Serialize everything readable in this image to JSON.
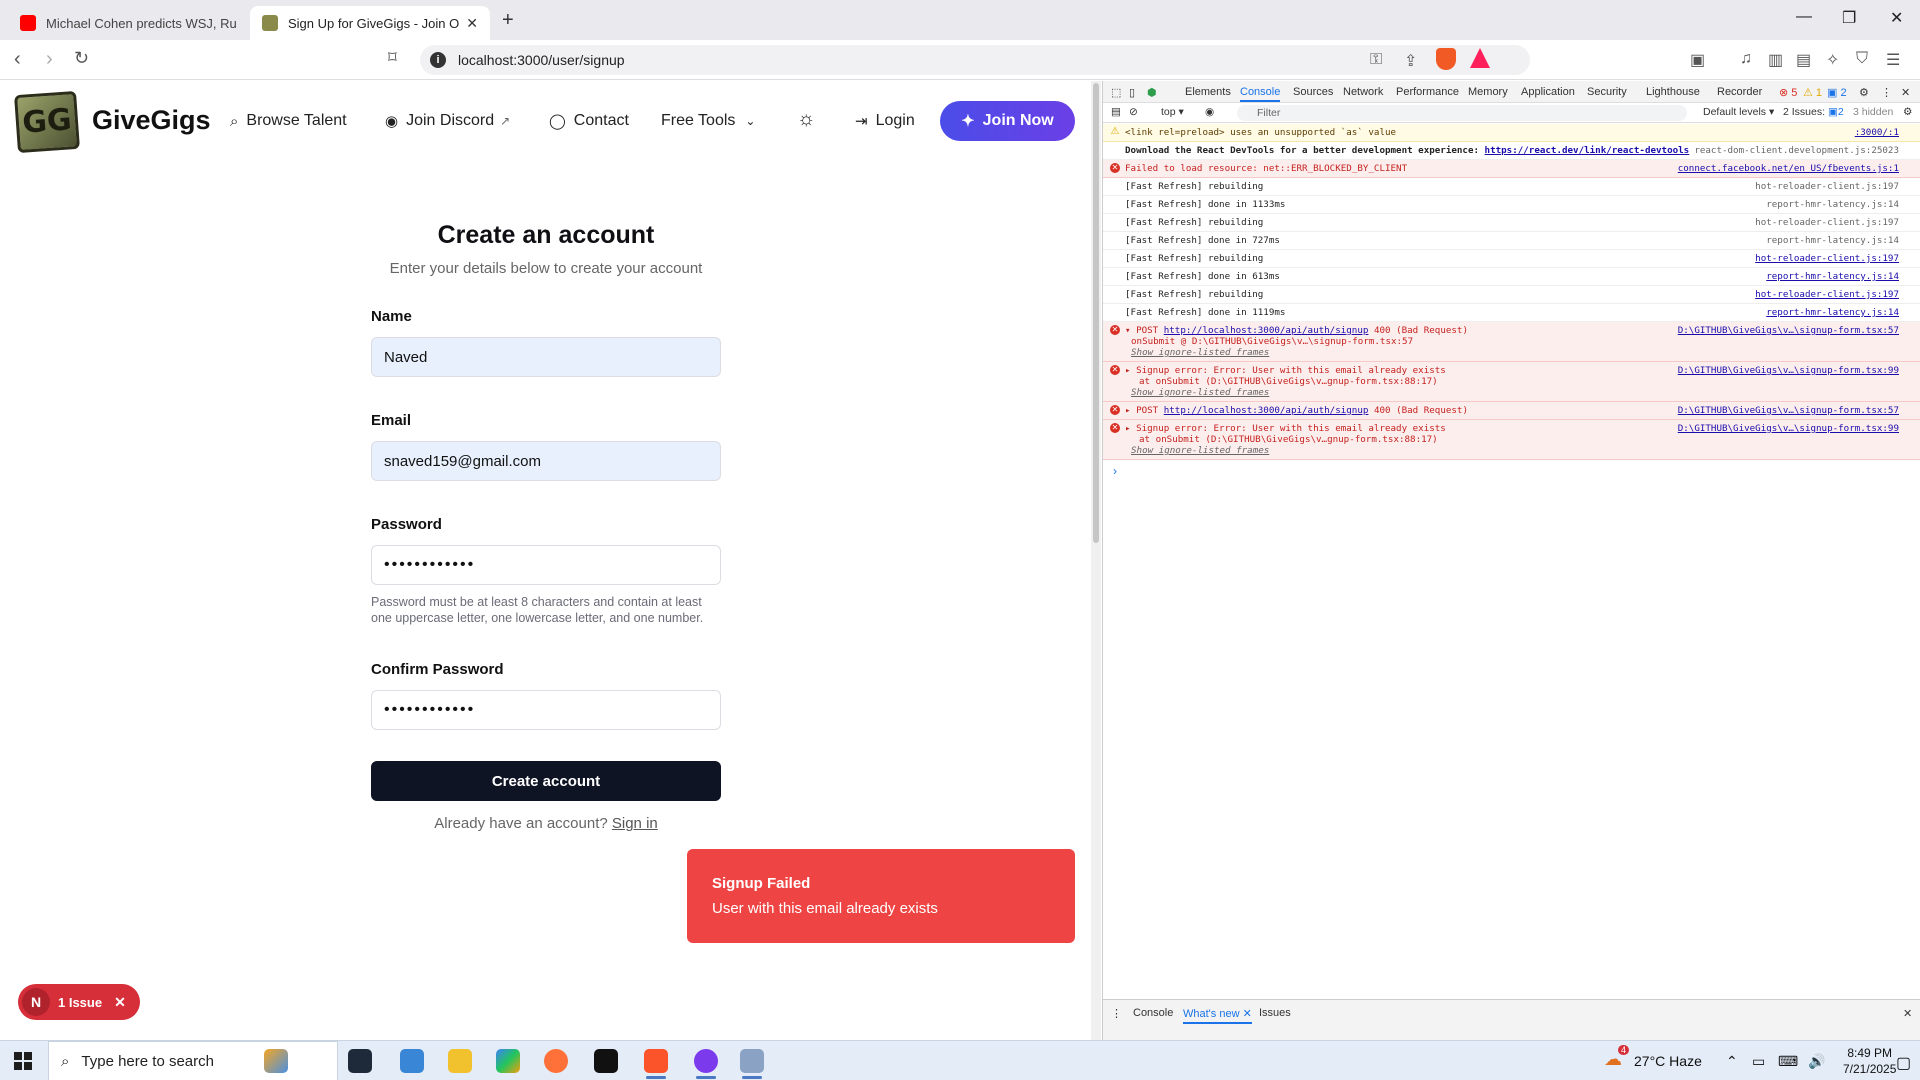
{
  "browser": {
    "tabs": [
      {
        "title": "Michael Cohen predicts WSJ, Rupert",
        "favicon_color": "#ff0000"
      },
      {
        "title": "Sign Up for GiveGigs - Join Our C",
        "favicon_color": "#8a8a4a"
      }
    ],
    "url": "localhost:3000/user/signup"
  },
  "site": {
    "brand": "GiveGigs",
    "logo_text": "GG",
    "nav": {
      "browse": "Browse Talent",
      "discord": "Join Discord",
      "contact": "Contact",
      "tools": "Free Tools",
      "login": "Login",
      "join": "Join Now"
    }
  },
  "form": {
    "title": "Create an account",
    "subtitle": "Enter your details below to create your account",
    "name_label": "Name",
    "name_value": "Naved",
    "email_label": "Email",
    "email_value": "snaved159@gmail.com",
    "password_label": "Password",
    "password_value": "••••••••••••",
    "password_hint": "Password must be at least 8 characters and contain at least one uppercase letter, one lowercase letter, and one number.",
    "confirm_label": "Confirm Password",
    "confirm_value": "••••••••••••",
    "submit": "Create account",
    "signin_prefix": "Already have an account?",
    "signin_link": "Sign in"
  },
  "toast": {
    "title": "Signup Failed",
    "message": "User with this email already exists"
  },
  "issue_pill": {
    "badge": "N",
    "label": "1 Issue"
  },
  "devtools": {
    "tabs": [
      "Elements",
      "Console",
      "Sources",
      "Network",
      "Performance",
      "Memory",
      "Application",
      "Security",
      "Lighthouse",
      "Recorder"
    ],
    "counts": {
      "errors": "5",
      "warnings": "1",
      "info": "2"
    },
    "context": "top",
    "filter_placeholder": "Filter",
    "levels": "Default levels",
    "issues": "2 Issues:",
    "issues_count": "2",
    "hidden": "3 hidden",
    "lines": [
      {
        "type": "warn",
        "text": "<link rel=preload> uses an unsupported `as` value",
        "src": ":3000/:1",
        "src_link": true
      },
      {
        "type": "info-bold",
        "text": "Download the React DevTools for a better development experience: ",
        "link": "https://react.dev/link/react-devtools",
        "src": "react-dom-client.development.js:25023",
        "src_link": false
      },
      {
        "type": "err",
        "text": "Failed to load resource: net::ERR_BLOCKED_BY_CLIENT",
        "src": "connect.facebook.net/en_US/fbevents.js:1",
        "src_link": true
      },
      {
        "type": "log",
        "text": "[Fast Refresh] rebuilding",
        "src": "hot-reloader-client.js:197",
        "src_link": false
      },
      {
        "type": "log",
        "text": "[Fast Refresh] done in 1133ms",
        "src": "report-hmr-latency.js:14",
        "src_link": false
      },
      {
        "type": "log",
        "text": "[Fast Refresh] rebuilding",
        "src": "hot-reloader-client.js:197",
        "src_link": false
      },
      {
        "type": "log",
        "text": "[Fast Refresh] done in 727ms",
        "src": "report-hmr-latency.js:14",
        "src_link": false
      },
      {
        "type": "log",
        "text": "[Fast Refresh] rebuilding",
        "src": "hot-reloader-client.js:197",
        "src_link": true
      },
      {
        "type": "log",
        "text": "[Fast Refresh] done in 613ms",
        "src": "report-hmr-latency.js:14",
        "src_link": true
      },
      {
        "type": "log",
        "text": "[Fast Refresh] rebuilding",
        "src": "hot-reloader-client.js:197",
        "src_link": true
      },
      {
        "type": "log",
        "text": "[Fast Refresh] done in 1119ms",
        "src": "report-hmr-latency.js:14",
        "src_link": true
      }
    ],
    "errors": [
      {
        "prefix": "▾ POST ",
        "link": "http://localhost:3000/api/auth/signup",
        "suffix": " 400 (Bad Request)",
        "sub": "onSubmit @ D:\\GITHUB\\GiveGigs\\v…\\signup-form.tsx:57",
        "sub2": "Show ignore-listed frames",
        "src": "D:\\GITHUB\\GiveGigs\\v…\\signup-form.tsx:57"
      },
      {
        "prefix": "▸ Signup error: Error: User with this email already exists",
        "link": "",
        "suffix": "",
        "sub": "at onSubmit (D:\\GITHUB\\GiveGigs\\v…gnup-form.tsx:88:17)",
        "sub2": "Show ignore-listed frames",
        "src": "D:\\GITHUB\\GiveGigs\\v…\\signup-form.tsx:99"
      },
      {
        "prefix": "▸ POST ",
        "link": "http://localhost:3000/api/auth/signup",
        "suffix": " 400 (Bad Request)",
        "sub": "",
        "sub2": "",
        "src": "D:\\GITHUB\\GiveGigs\\v…\\signup-form.tsx:57"
      },
      {
        "prefix": "▸ Signup error: Error: User with this email already exists",
        "link": "",
        "suffix": "",
        "sub": "at onSubmit (D:\\GITHUB\\GiveGigs\\v…gnup-form.tsx:88:17)",
        "sub2": "Show ignore-listed frames",
        "src": "D:\\GITHUB\\GiveGigs\\v…\\signup-form.tsx:99"
      }
    ],
    "drawer_tabs": [
      "Console",
      "What's new",
      "Issues"
    ]
  },
  "taskbar": {
    "search_placeholder": "Type here to search",
    "weather_badge": "4",
    "weather": "27°C  Haze",
    "time": "8:49 PM",
    "date": "7/21/2025"
  }
}
